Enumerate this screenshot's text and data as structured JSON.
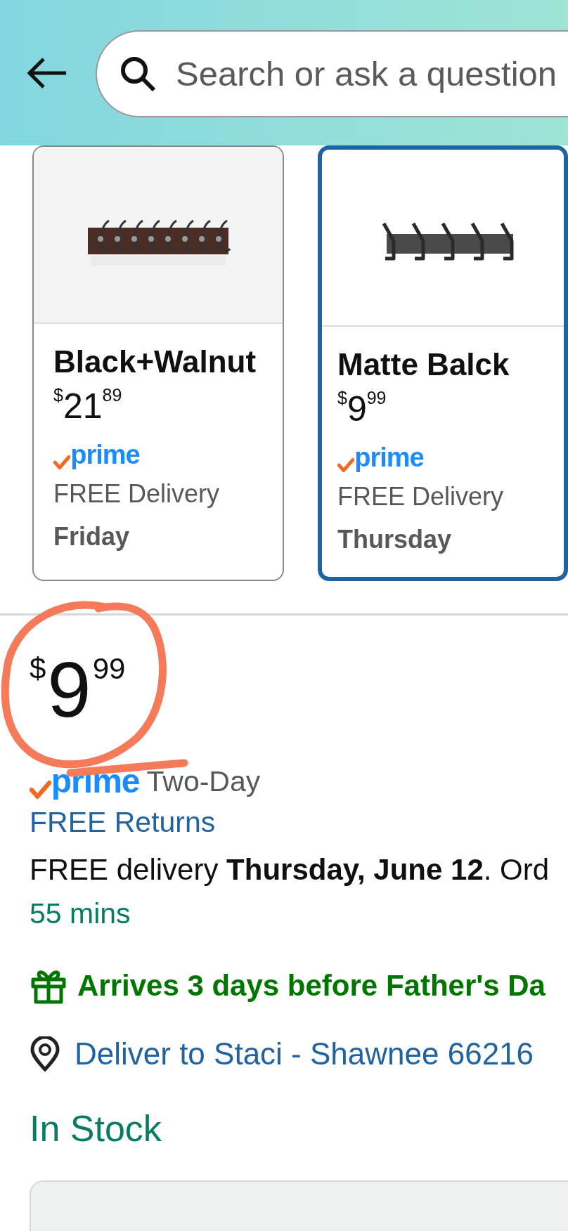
{
  "header": {
    "search": {
      "placeholder": "Search or ask a question"
    }
  },
  "variants": [
    {
      "kind": "walnut",
      "name": "Black+Walnut",
      "price": {
        "currency": "$",
        "whole": "21",
        "fraction": "89"
      },
      "badge": "prime",
      "delivery": "FREE Delivery",
      "day": "Friday",
      "selected": false
    },
    {
      "kind": "black",
      "name": "Matte Balck",
      "price": {
        "currency": "$",
        "whole": "9",
        "fraction": "99"
      },
      "badge": "prime",
      "delivery": "FREE Delivery",
      "day": "Thursday",
      "selected": true
    }
  ],
  "buybox": {
    "price": {
      "currency": "$",
      "whole": "9",
      "fraction": "99"
    },
    "prime": {
      "badge": "prime",
      "speed": "Two-Day"
    },
    "returns": "FREE Returns",
    "delivery": "FREE delivery **Thursday, June 12**. Ord",
    "countdown": "55 mins",
    "gift_message": "Arrives 3 days before Father's Da",
    "deliver_to": "Deliver to Staci - Shawnee 66216",
    "stock": "In Stock"
  }
}
